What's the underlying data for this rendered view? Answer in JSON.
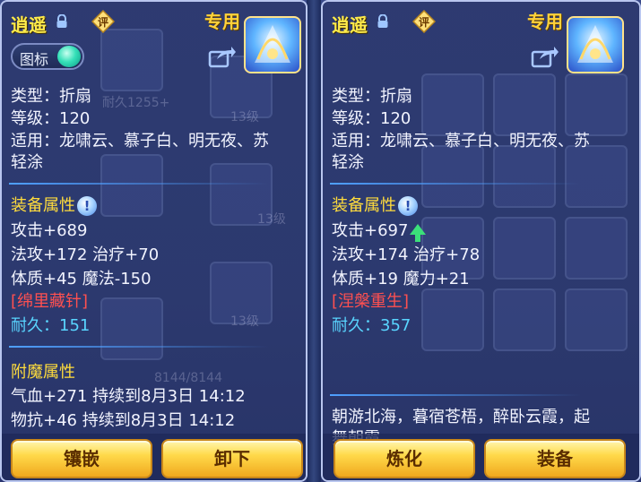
{
  "left": {
    "name": "逍遥",
    "ping_label": "评",
    "zhuanyong": "专用",
    "toggle_label": "图标",
    "ghost_durability": "耐久1255+",
    "ghost_level_a": "13级",
    "ghost_level_b": "13级",
    "ghost_level_c": "13级",
    "ghost_hp": "8144/8144",
    "type_line": "类型：折扇",
    "level_line": "等级：120",
    "use_line_1": "适用：龙啸云、慕子白、明无夜、苏",
    "use_line_2": "轻涂",
    "attr_title": "装备属性",
    "info_label": "!",
    "attr_1": "攻击+689",
    "attr_2": "法攻+172 治疗+70",
    "attr_3": "体质+45 魔法-150",
    "special": "[绵里藏针]",
    "durability_label": "耐久：",
    "durability_value": "151",
    "enchant_title": "附魔属性",
    "enchant_1": "气血+271 持续到8月3日 14:12",
    "enchant_2": "物抗+46 持续到8月3日 14:12",
    "btn_left": "镶嵌",
    "btn_right": "卸下"
  },
  "right": {
    "name": "逍遥",
    "ping_label": "评",
    "zhuanyong": "专用",
    "type_line": "类型：折扇",
    "level_line": "等级：120",
    "use_line_1": "适用：龙啸云、慕子白、明无夜、苏",
    "use_line_2": "轻涂",
    "attr_title": "装备属性",
    "info_label": "!",
    "attr_1": "攻击+697",
    "attr_2": "法攻+174 治疗+78",
    "attr_3": "体质+19 魔力+21",
    "special": "[涅槃重生]",
    "durability_label": "耐久：",
    "durability_value": "357",
    "desc_1": "朝游北海，暮宿苍梧，醉卧云霞，起",
    "desc_2": "舞朝霞",
    "btn_left": "炼化",
    "btn_right": "装备"
  },
  "colors": {
    "name": "#ffeb4a",
    "section": "#ffdc3c",
    "special": "#ff5050",
    "durability": "#59d5ff",
    "button": "#ffd94a"
  }
}
